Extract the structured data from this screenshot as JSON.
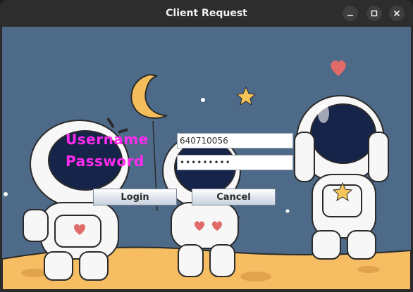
{
  "window": {
    "title": "Client Request",
    "controls": [
      "minimize-icon",
      "maximize-icon",
      "close-icon"
    ]
  },
  "form": {
    "username_label": "Username",
    "password_label": "Password",
    "username_value": "640710056",
    "password_value": "•••••••••",
    "login_label": "Login",
    "cancel_label": "Cancel"
  },
  "colors": {
    "background": "#4d6b88",
    "label": "#ff2bf0",
    "titlebar": "#2d2d2d",
    "ground": "#f6bd62"
  }
}
